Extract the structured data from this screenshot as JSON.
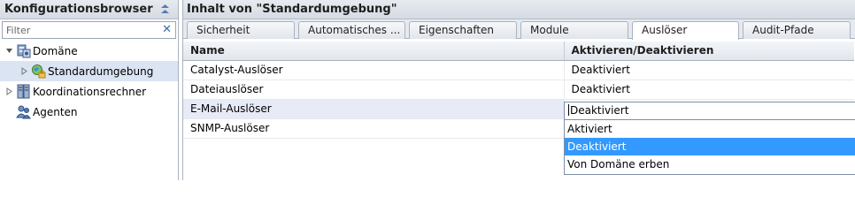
{
  "left_panel": {
    "title": "Konfigurationsbrowser",
    "filter_placeholder": "Filter",
    "tree": [
      {
        "label": "Domäne",
        "icon": "domain-icon"
      },
      {
        "label": "Standardumgebung",
        "icon": "environment-icon"
      },
      {
        "label": "Koordinationsrechner",
        "icon": "server-icon"
      },
      {
        "label": "Agenten",
        "icon": "agents-icon"
      }
    ]
  },
  "right_panel": {
    "title": "Inhalt von \"Standardumgebung\"",
    "tabs": [
      "Sicherheit",
      "Automatisches ...",
      "Eigenschaften",
      "Module",
      "Auslöser",
      "Audit-Pfade"
    ],
    "active_tab": "Auslöser",
    "columns": [
      "Name",
      "Aktivieren/Deaktivieren"
    ],
    "rows": [
      {
        "name": "Catalyst-Auslöser",
        "value": "Deaktiviert"
      },
      {
        "name": "Dateiauslöser",
        "value": "Deaktiviert"
      },
      {
        "name": "E-Mail-Auslöser",
        "value": ""
      },
      {
        "name": "SNMP-Auslöser",
        "value": ""
      }
    ],
    "editor": {
      "current": "Deaktiviert",
      "options": [
        "Aktiviert",
        "Deaktiviert",
        "Von Domäne erben"
      ],
      "selected": "Deaktiviert"
    }
  },
  "colors": {
    "selection": "#3399ff",
    "header_bg": "#dde2e9",
    "tree_selection": "#dbe4f3"
  }
}
